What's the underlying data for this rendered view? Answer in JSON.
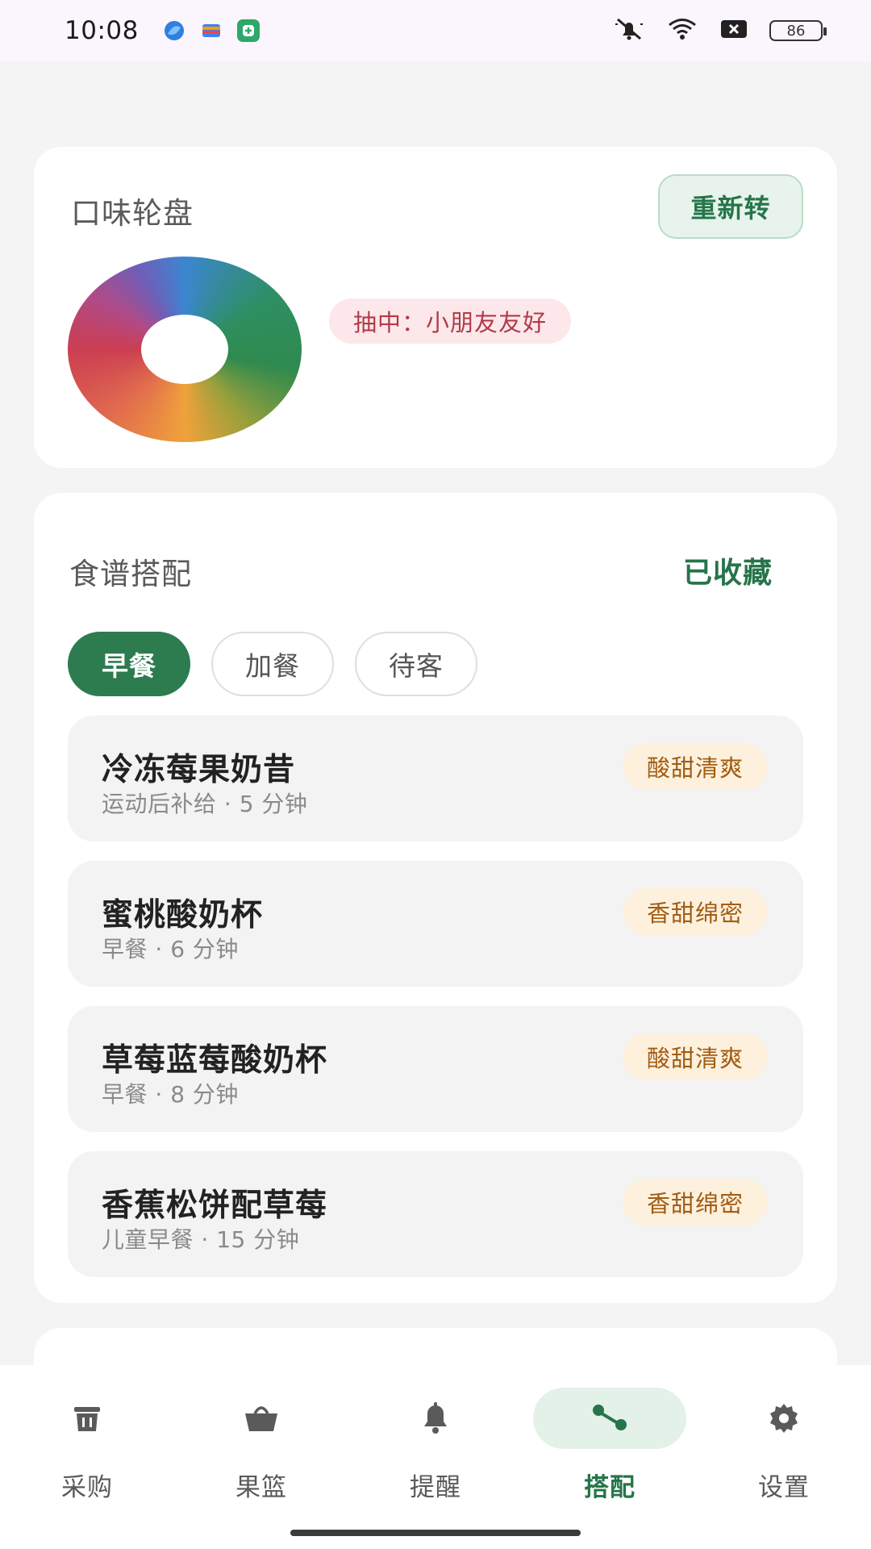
{
  "status_bar": {
    "time": "10:08",
    "battery": "86",
    "icons": [
      "app-icon-blue",
      "app-icon-wallet",
      "app-icon-green",
      "mute-icon",
      "wifi-icon",
      "close-box-icon",
      "battery-icon"
    ]
  },
  "wheel": {
    "title": "口味轮盘",
    "respin_label": "重新转",
    "result": "抽中：小朋友友好"
  },
  "recipes": {
    "title": "食谱搭配",
    "saved_label": "已收藏",
    "tabs": [
      {
        "label": "早餐",
        "active": true
      },
      {
        "label": "加餐",
        "active": false
      },
      {
        "label": "待客",
        "active": false
      }
    ],
    "items": [
      {
        "name": "冷冻莓果奶昔",
        "meta": "运动后补给 · 5 分钟",
        "tag": "酸甜清爽"
      },
      {
        "name": "蜜桃酸奶杯",
        "meta": "早餐 · 6 分钟",
        "tag": "香甜绵密"
      },
      {
        "name": "草莓蓝莓酸奶杯",
        "meta": "早餐 · 8 分钟",
        "tag": "酸甜清爽"
      },
      {
        "name": "香蕉松饼配草莓",
        "meta": "儿童早餐 · 15 分钟",
        "tag": "香甜绵密"
      }
    ]
  },
  "nav": {
    "items": [
      {
        "label": "采购",
        "icon": "trash-bin-icon",
        "active": false
      },
      {
        "label": "果篮",
        "icon": "basket-icon",
        "active": false
      },
      {
        "label": "提醒",
        "icon": "bell-icon",
        "active": false
      },
      {
        "label": "搭配",
        "icon": "link-nodes-icon",
        "active": true
      },
      {
        "label": "设置",
        "icon": "gear-icon",
        "active": false
      }
    ]
  },
  "colors": {
    "primary_green": "#2c7c50",
    "tag_orange": "#a35c12",
    "result_red": "#b23a48"
  }
}
